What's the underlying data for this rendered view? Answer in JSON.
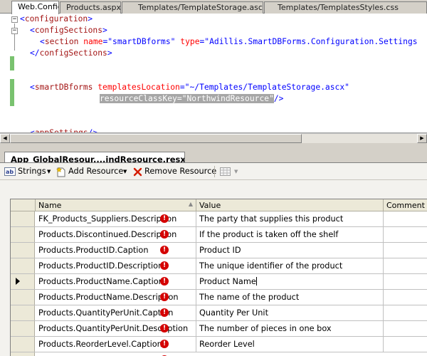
{
  "doc_tabs": [
    {
      "label": "Web.Config",
      "active": true
    },
    {
      "label": "Products.aspx",
      "active": false
    },
    {
      "label": "Templates/TemplateStorage.ascx",
      "active": false
    },
    {
      "label": "Templates/TemplatesStyles.css",
      "active": false
    }
  ],
  "editor": {
    "lines": {
      "l1": {
        "open": "<",
        "el": "configuration",
        "close": ">"
      },
      "l2": {
        "open": "<",
        "el": "configSections",
        "close": ">"
      },
      "l3": {
        "open": "<",
        "el": "section",
        "attr1": " name",
        "eq1": "=\"",
        "val1": "smartDBforms",
        "q1": "\"",
        "attr2": " type",
        "eq2": "=\"",
        "val2": "Adillis.SmartDBForms.Configuration.Settings"
      },
      "l4": {
        "open": "</",
        "el": "configSections",
        "close": ">"
      },
      "l5": {
        "open": "<",
        "el": "smartDBforms",
        "attr1": " templatesLocation",
        "eq1": "=\"",
        "val1": "~/Templates/TemplateStorage.ascx",
        "q1": "\""
      },
      "l6": {
        "attr": "resourceClassKey",
        "eq": "=\"",
        "val": "NorthwindResource",
        "q": "\"",
        "close": "/>"
      },
      "l7": {
        "open": "<",
        "el": "appSettings",
        "close": "/>"
      }
    }
  },
  "resource_tab": {
    "label": "App_GlobalResour....indResource.resx"
  },
  "toolbar": {
    "strings_label": "Strings",
    "add_resource_label": "Add Resource",
    "remove_resource_label": "Remove Resource"
  },
  "grid": {
    "columns": {
      "name": "Name",
      "value": "Value",
      "comment": "Comment"
    },
    "rows": [
      {
        "name": "FK_Products_Suppliers.Description",
        "value": "The party that supplies this product",
        "comment": ""
      },
      {
        "name": "Products.Discontinued.Description",
        "value": "If the product is taken off the shelf",
        "comment": ""
      },
      {
        "name": "Products.ProductID.Caption",
        "value": "Product ID",
        "comment": ""
      },
      {
        "name": "Products.ProductID.Description",
        "value": "The unique identifier of the product",
        "comment": ""
      },
      {
        "name": "Products.ProductName.Caption",
        "value": "Product Name",
        "comment": ""
      },
      {
        "name": "Products.ProductName.Description",
        "value": "The name of the product",
        "comment": ""
      },
      {
        "name": "Products.QuantityPerUnit.Caption",
        "value": "Quantity Per Unit",
        "comment": ""
      },
      {
        "name": "Products.QuantityPerUnit.Description",
        "value": "The number of pieces in one box",
        "comment": ""
      },
      {
        "name": "Products.ReorderLevel.Caption",
        "value": "Reorder Level",
        "comment": ""
      }
    ],
    "current_row": 4,
    "error_marker": "!"
  },
  "colors": {
    "xml_bracket": "#0000ff",
    "xml_element": "#a31515",
    "xml_attribute": "#ff0000",
    "xml_value": "#0000ff",
    "error_icon": "#d40000",
    "change_bar": "#79c26f"
  },
  "icons": [
    "strings-icon",
    "add-resource-icon",
    "remove-resource-icon",
    "views-icon",
    "error-icon",
    "current-row-arrow-icon"
  ]
}
